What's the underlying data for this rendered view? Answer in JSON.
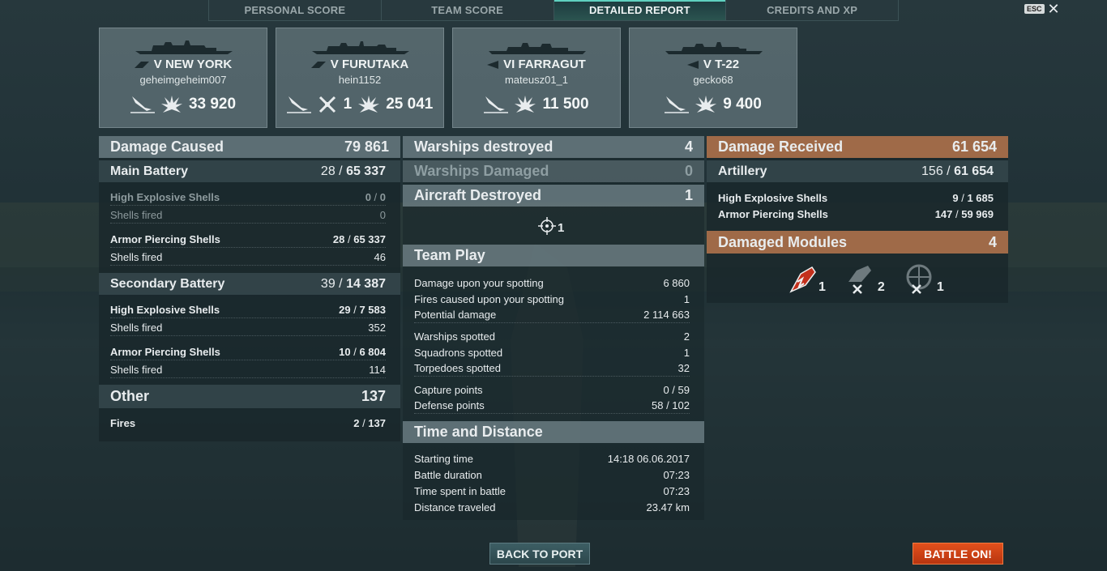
{
  "tabs": [
    "PERSONAL SCORE",
    "TEAM SCORE",
    "DETAILED REPORT",
    "CREDITS AND XP"
  ],
  "esc_label": "ESC",
  "ships": [
    {
      "name": "V NEW YORK",
      "player": "geheimgeheim007",
      "stats": [
        {
          "icon": "ship-sunk-icon",
          "value": ""
        },
        {
          "icon": "damage-burst-icon",
          "value": "33 920"
        }
      ]
    },
    {
      "name": "V FURUTAKA",
      "player": "hein1152",
      "stats": [
        {
          "icon": "ship-sunk-icon",
          "value": ""
        },
        {
          "icon": "plane-shot-icon",
          "value": "1"
        },
        {
          "icon": "damage-burst-icon",
          "value": "25 041"
        }
      ]
    },
    {
      "name": "VI FARRAGUT",
      "player": "mateusz01_1",
      "stats": [
        {
          "icon": "ship-sunk-icon",
          "value": ""
        },
        {
          "icon": "damage-burst-icon",
          "value": "11 500"
        }
      ]
    },
    {
      "name": "V T-22",
      "player": "gecko68",
      "stats": [
        {
          "icon": "ship-sunk-icon",
          "value": ""
        },
        {
          "icon": "damage-burst-icon",
          "value": "9 400"
        }
      ]
    }
  ],
  "damage": {
    "title": "Damage Caused",
    "total": "79 861",
    "main": {
      "label": "Main Battery",
      "hits": "28",
      "dmg": "65 337",
      "he": {
        "label": "High Explosive Shells",
        "hits": "0",
        "dmg": "0",
        "fired_label": "Shells fired",
        "fired": "0"
      },
      "ap": {
        "label": "Armor Piercing Shells",
        "hits": "28",
        "dmg": "65 337",
        "fired_label": "Shells fired",
        "fired": "46"
      }
    },
    "secondary": {
      "label": "Secondary Battery",
      "hits": "39",
      "dmg": "14 387",
      "he": {
        "label": "High Explosive Shells",
        "hits": "29",
        "dmg": "7 583",
        "fired_label": "Shells fired",
        "fired": "352"
      },
      "ap": {
        "label": "Armor Piercing Shells",
        "hits": "10",
        "dmg": "6 804",
        "fired_label": "Shells fired",
        "fired": "114"
      }
    },
    "other": {
      "label": "Other",
      "total": "137",
      "fires_label": "Fires",
      "fires_hits": "2",
      "fires_dmg": "137"
    }
  },
  "middle": {
    "warships_destroyed": {
      "label": "Warships destroyed",
      "value": "4"
    },
    "warships_damaged": {
      "label": "Warships Damaged",
      "value": "0"
    },
    "aircraft": {
      "label": "Aircraft Destroyed",
      "value": "1"
    },
    "crosshair_value": "1",
    "team_play": {
      "title": "Team Play",
      "rows": [
        {
          "label": "Damage upon your spotting",
          "value": "6 860"
        },
        {
          "label": "Fires caused upon your spotting",
          "value": "1"
        },
        {
          "label": "Potential damage",
          "value": "2 114 663"
        },
        {
          "label": "Warships spotted",
          "value": "2"
        },
        {
          "label": "Squadrons spotted",
          "value": "1"
        },
        {
          "label": "Torpedoes spotted",
          "value": "32"
        },
        {
          "label": "Capture points",
          "value": "0 / 59"
        },
        {
          "label": "Defense points",
          "value": "58 / 102"
        }
      ]
    },
    "time": {
      "title": "Time and Distance",
      "rows": [
        {
          "label": "Starting time",
          "value": "14:18  06.06.2017"
        },
        {
          "label": "Battle duration",
          "value": "07:23"
        },
        {
          "label": "Time spent in battle",
          "value": "07:23"
        },
        {
          "label": "Distance traveled",
          "value": "23.47 km"
        }
      ]
    }
  },
  "received": {
    "title": "Damage Received",
    "total": "61 654",
    "artillery": {
      "label": "Artillery",
      "hits": "156",
      "dmg": "61 654"
    },
    "he": {
      "label": "High Explosive Shells",
      "hits": "9",
      "dmg": "1 685"
    },
    "ap": {
      "label": "Armor Piercing Shells",
      "hits": "147",
      "dmg": "59 969"
    },
    "modules": {
      "title": "Damaged Modules",
      "total": "4",
      "items": [
        {
          "icon": "engine-damaged-icon",
          "value": "1"
        },
        {
          "icon": "turret-destroyed-icon",
          "value": "2"
        },
        {
          "icon": "aa-gun-destroyed-icon",
          "value": "1"
        }
      ]
    }
  },
  "buttons": {
    "back": "BACK TO PORT",
    "battle": "BATTLE ON!"
  },
  "colors": {
    "accent": "#5fd1c0",
    "received": "#a66e4a",
    "battle": "#d2441a"
  }
}
